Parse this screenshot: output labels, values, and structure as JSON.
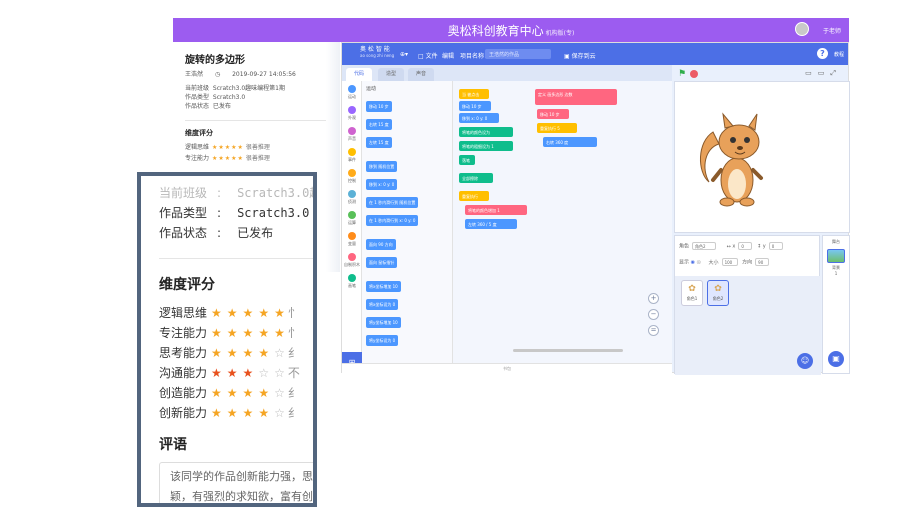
{
  "header": {
    "center_title": "奥松科创教育中心",
    "center_subtitle": "机构版(专)",
    "user_name": "于老师"
  },
  "info": {
    "work_title": "旋转的多边形",
    "author": "王浩然",
    "datetime": "2019-09-27 14:05:56",
    "rows": [
      {
        "label": "当前班级",
        "value": "Scratch3.0趣味编程第1期"
      },
      {
        "label": "作品类型",
        "value": "Scratch3.0"
      },
      {
        "label": "作品状态",
        "value": "已发布"
      }
    ],
    "dimension_heading": "维度评分",
    "scores": [
      {
        "name": "逻辑思维",
        "stars": "★★★★★",
        "tag": "很善推理"
      },
      {
        "name": "专注能力",
        "stars": "★★★★★",
        "tag": "很善推理"
      }
    ]
  },
  "editor": {
    "logo_line1": "奥 松 智 能",
    "logo_line2": "ao song zhi neng",
    "menu_file": "文件",
    "menu_edit": "编辑",
    "project_label": "项目名称：",
    "project_placeholder": "王浩然的作品",
    "save_label": "保存到云",
    "help_label": "教程",
    "tabs": [
      "代码",
      "造型",
      "声音"
    ],
    "categories": [
      "运动",
      "外观",
      "声音",
      "事件",
      "控制",
      "侦测",
      "运算",
      "变量",
      "自制积木",
      "画笔"
    ],
    "palette_heading": "运动",
    "palette_blocks": [
      "移动 10 步",
      "右转 15 度",
      "左转 15 度",
      "移到 随机位置",
      "移到 x: 0 y: 0",
      "在 1 秒内滑行到 随机位置",
      "在 1 秒内滑行到 x: 0 y: 0",
      "面向 90 方向",
      "面向 鼠标指针",
      "将x坐标增加 10",
      "将x坐标设为 0",
      "将y坐标增加 10",
      "将y坐标设为 0"
    ],
    "script_blocks": [
      "当 被点击",
      "移动 10 步",
      "移到 x: 0 y: 0",
      "将笔的颜色设为",
      "将笔的粗细设为 1",
      "落笔",
      "全部擦除",
      "重复执行",
      "右转 15 度",
      "将笔的颜色增加 1",
      "左转 360 / 5 度",
      "定义 画多边形 边数",
      "移动 10 步",
      "重复执行 5",
      "右转 360 度"
    ],
    "bottom_label": "书包",
    "sprite_label": "角色",
    "sprite_name": "角色2",
    "x_label": "x",
    "x_value": "0",
    "y_label": "y",
    "y_value": "0",
    "show_label": "显示",
    "size_label": "大小",
    "size_value": "100",
    "direction_label": "方向",
    "direction_value": "90",
    "sprites": [
      "角色1",
      "角色2"
    ],
    "stage_label": "舞台",
    "backdrop_label": "背景",
    "backdrop_count": "1"
  },
  "zoom": {
    "rows": [
      {
        "label": "当前班级",
        "colon": ":",
        "value": "Scratch3.0趣",
        "faded": true
      },
      {
        "label": "作品类型",
        "colon": ":",
        "value": "Scratch3.0"
      },
      {
        "label": "作品状态",
        "colon": ":",
        "value": "已发布"
      }
    ],
    "dimension_heading": "维度评分",
    "scores": [
      {
        "name": "逻辑思维",
        "on": 5,
        "off": 0,
        "red": false,
        "tail": "忄"
      },
      {
        "name": "专注能力",
        "on": 5,
        "off": 0,
        "red": false,
        "tail": "忄"
      },
      {
        "name": "思考能力",
        "on": 4,
        "off": 1,
        "red": false,
        "tail": "纟"
      },
      {
        "name": "沟通能力",
        "on": 3,
        "off": 2,
        "red": true,
        "tail": "不"
      },
      {
        "name": "创造能力",
        "on": 4,
        "off": 1,
        "red": false,
        "tail": "纟"
      },
      {
        "name": "创新能力",
        "on": 4,
        "off": 1,
        "red": false,
        "tail": "纟"
      }
    ],
    "comment_heading": "评语",
    "comment_line1": "该同学的作品创新能力强，思",
    "comment_line2": "颖，有强烈的求知欲，富有创"
  },
  "colors": {
    "header_purple": "#9c5cf0",
    "editor_blue": "#4c6fe6",
    "star_orange": "#f5a524",
    "star_red": "#e8521e",
    "panel_border": "#52657e"
  }
}
